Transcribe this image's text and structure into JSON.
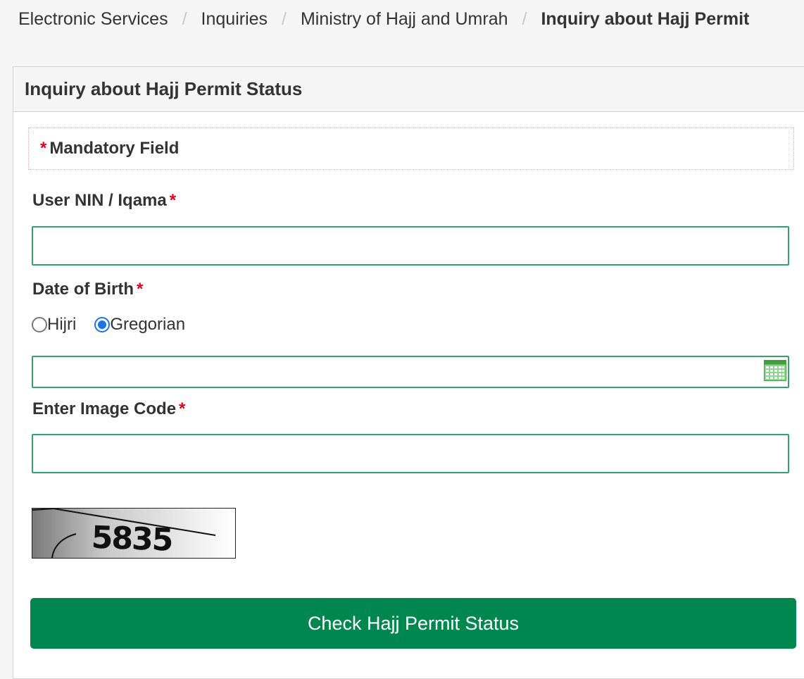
{
  "breadcrumb": {
    "items": [
      "Electronic Services",
      "Inquiries",
      "Ministry of Hajj and Umrah"
    ],
    "current": "Inquiry about Hajj Permit",
    "separator": "/"
  },
  "panel": {
    "title": "Inquiry about Hajj Permit Status"
  },
  "mandatory_note": {
    "asterisk": "*",
    "text": "Mandatory Field"
  },
  "form": {
    "nin": {
      "label": "User NIN / Iqama",
      "required_marker": "*",
      "value": ""
    },
    "dob": {
      "label": "Date of Birth",
      "required_marker": "*",
      "calendar_options": [
        "Hijri",
        "Gregorian"
      ],
      "selected": "Gregorian",
      "value": "",
      "icon": "calendar-icon"
    },
    "image_code": {
      "label": "Enter Image Code",
      "required_marker": "*",
      "value": ""
    },
    "captcha_text": "5835",
    "submit_label": "Check Hajj Permit Status"
  },
  "colors": {
    "accent": "#00874f",
    "input_border": "#2fa36b",
    "required": "#e0001b",
    "radio_selected": "#1a73e8"
  }
}
